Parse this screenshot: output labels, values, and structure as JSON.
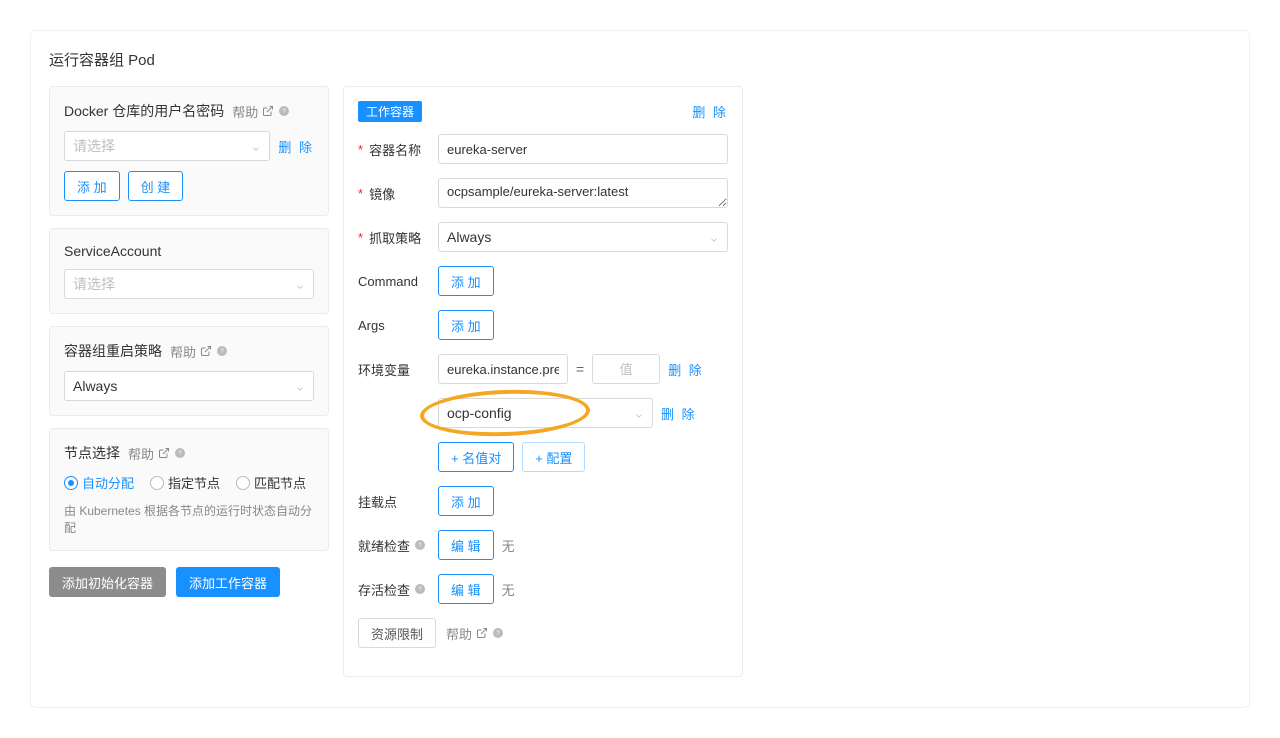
{
  "pageTitle": "运行容器组 Pod",
  "side": {
    "docker": {
      "title": "Docker 仓库的用户名密码",
      "placeholder": "请选择",
      "delete": "删 除",
      "add": "添 加",
      "create": "创 建"
    },
    "serviceAccount": {
      "title": "ServiceAccount",
      "placeholder": "请选择"
    },
    "restart": {
      "title": "容器组重启策略",
      "value": "Always"
    },
    "node": {
      "title": "节点选择",
      "opt1": "自动分配",
      "opt2": "指定节点",
      "opt3": "匹配节点",
      "hint": "由 Kubernetes 根据各节点的运行时状态自动分配"
    }
  },
  "buttons": {
    "initContainer": "添加初始化容器",
    "workContainer": "添加工作容器"
  },
  "helpText": "帮助",
  "right": {
    "tag": "工作容器",
    "delete": "删 除",
    "containerNameLabel": "容器名称",
    "containerNameValue": "eureka-server",
    "imageLabel": "镜像",
    "imageValue": "ocpsample/eureka-server:latest",
    "pullPolicyLabel": "抓取策略",
    "pullPolicyValue": "Always",
    "commandLabel": "Command",
    "argsLabel": "Args",
    "addBtn": "添 加",
    "envLabel": "环境变量",
    "envKey": "eureka.instance.preferIpAddress",
    "envValPlaceholder": "值",
    "configSelected": "ocp-config",
    "kvBtn": "+ 名值对",
    "cfgBtn": "+ 配置",
    "mountLabel": "挂载点",
    "readyLabel": "就绪检查",
    "liveLabel": "存活检查",
    "editBtn": "编 辑",
    "noText": "无",
    "resLimitBtn": "资源限制"
  }
}
